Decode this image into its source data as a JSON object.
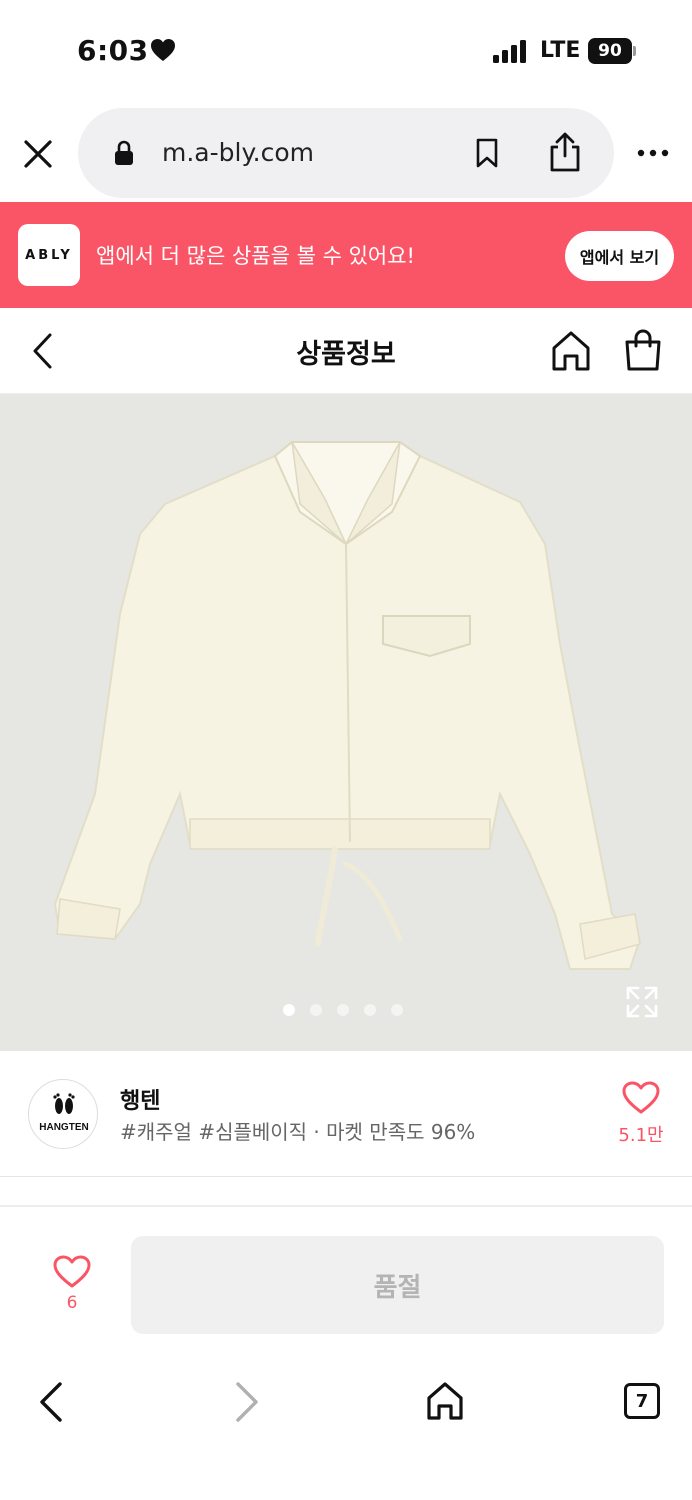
{
  "status_bar": {
    "time": "6:03",
    "network": "LTE",
    "battery": "90"
  },
  "browser": {
    "url": "m.a-bly.com"
  },
  "app_banner": {
    "logo_text": "ABLY",
    "message": "앱에서 더 많은 상품을 볼 수 있어요!",
    "button_label": "앱에서 보기",
    "color": "#fa5567"
  },
  "header": {
    "title": "상품정보"
  },
  "gallery": {
    "image_alt": "cream cropped shirt jacket",
    "total_images": 5,
    "current_index": 1
  },
  "shop": {
    "name": "행텐",
    "meta": "#캐주얼 #심플베이직 · 마켓 만족도 96%",
    "logo_text": "HANGTEN",
    "like_count": "5.1만"
  },
  "purchase": {
    "wish_count": "6",
    "button_label": "품절"
  },
  "bottom_nav": {
    "tab_count": "7"
  }
}
